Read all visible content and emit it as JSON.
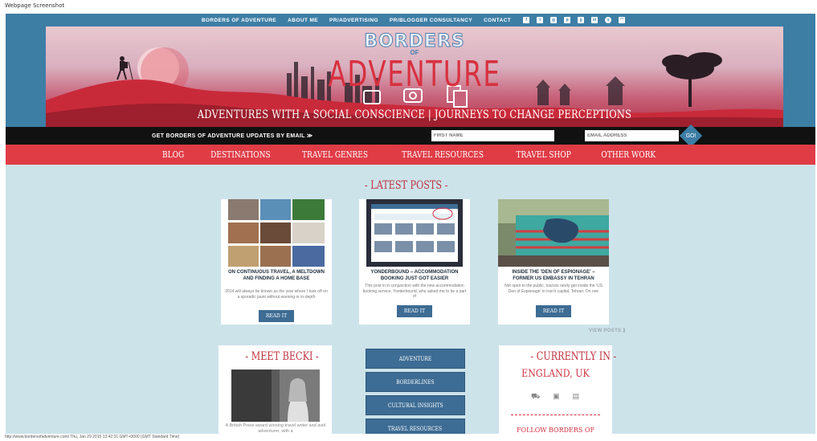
{
  "screenshot_label": "Webpage Screenshot",
  "top_nav": {
    "items": [
      "BORDERS OF ADVENTURE",
      "ABOUT ME",
      "PR/ADVERTISING",
      "PR/BLOGGER CONSULTANCY",
      "CONTACT"
    ],
    "social_icons": [
      "facebook-icon",
      "twitter-icon",
      "instagram-icon",
      "pinterest-icon",
      "google-plus-icon",
      "linkedin-icon",
      "stumbleupon-icon",
      "rss-icon"
    ]
  },
  "banner": {
    "logo_top": "BORDERS",
    "logo_of": "OF",
    "logo_main": "ADVENTURE",
    "tagline": "ADVENTURES WITH A SOCIAL CONSCIENCE  |  JOURNEYS TO CHANGE PERCEPTIONS"
  },
  "email_signup": {
    "prompt": "GET BORDERS OF ADVENTURE UPDATES BY EMAIL ≫",
    "first_name_placeholder": "FIRST NAME",
    "email_placeholder": "EMAIL ADDRESS",
    "button": "GO!"
  },
  "main_nav": [
    "BLOG",
    "DESTINATIONS",
    "TRAVEL GENRES",
    "TRAVEL RESOURCES",
    "TRAVEL SHOP",
    "OTHER WORK"
  ],
  "latest_posts": {
    "title": "- LATEST POSTS -",
    "posts": [
      {
        "title": "ON CONTINUOUS TRAVEL, A MELTDOWN AND FINDING A HOME BASE",
        "excerpt": "2014 will always be known as the year where I took off on a sporadic jaunt without warning or in-depth",
        "button": "READ IT"
      },
      {
        "title": "YONDERBOUND – ACCOMMODATION BOOKING JUST GOT EASIER",
        "excerpt": "This post in in conjunction with the new accommodation booking service, Yonderbound, who asked me to be a part of",
        "button": "READ IT"
      },
      {
        "title": "INSIDE THE 'DEN OF ESPIONAGE' – FORMER US EMBASSY IN TEHRAN",
        "excerpt": "Not open to the public, tourists rarely get inside the 'US Den of Espionage' in Iran's capital, Tehran. On one",
        "button": "READ IT"
      }
    ],
    "view_posts": "VIEW POSTS ⟫"
  },
  "meet": {
    "title": "- MEET BECKI -",
    "bio": "A British Press award winning travel writer and avid adventurer, with a"
  },
  "categories": [
    "ADVENTURE",
    "BORDERLINES",
    "CULTURAL INSIGHTS",
    "TRAVEL RESOURCES"
  ],
  "currently_in": {
    "title": "- CURRENTLY IN -",
    "location": "ENGLAND, UK",
    "icons": [
      "bus-icon",
      "camera-icon",
      "document-icon"
    ],
    "follow": "FOLLOW BORDERS OF"
  },
  "footer_url": "http://www.bordersofadventure.com/ Thu, Jan 29 2015 13:42:31 GMT+0000 (GMT Standard Time)",
  "colors": {
    "nav_blue": "#3d7ea5",
    "accent_red": "#e03c46",
    "page_bg": "#cde3ea"
  }
}
